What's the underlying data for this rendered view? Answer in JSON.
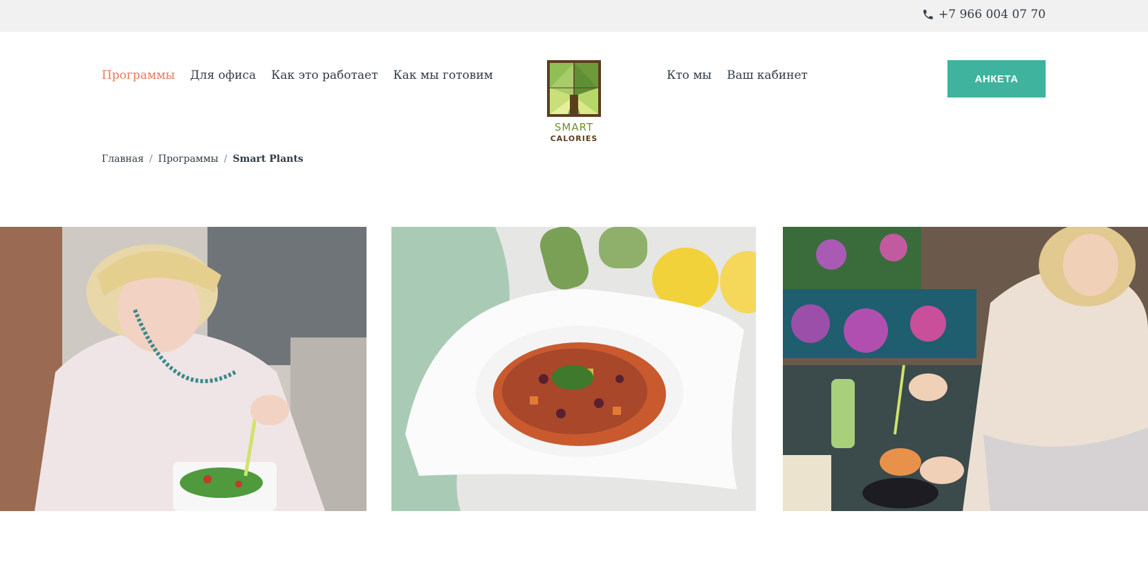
{
  "topbar": {
    "phone": "+7 966 004 07 70",
    "phone_icon": "phone-icon"
  },
  "nav": {
    "left": [
      {
        "label": "Программы",
        "active": true
      },
      {
        "label": "Для офиса",
        "active": false
      },
      {
        "label": "Как это работает",
        "active": false
      },
      {
        "label": "Как мы готовим",
        "active": false
      }
    ],
    "right": [
      {
        "label": "Кто мы"
      },
      {
        "label": "Ваш кабинет"
      }
    ]
  },
  "logo": {
    "line1": "SMART",
    "line2": "CALORIES"
  },
  "cta": {
    "label": "АНКЕТА"
  },
  "breadcrumb": {
    "home": "Главная",
    "section": "Программы",
    "current": "Smart Plants"
  },
  "colors": {
    "accent": "#3fb39d",
    "active_nav": "#e8785c",
    "topbar": "#f1f1f1",
    "text": "#2f3b45"
  },
  "gallery": [
    "woman-eating-salad-photo",
    "bean-stew-plate-photo",
    "woman-eating-at-table-photo"
  ]
}
